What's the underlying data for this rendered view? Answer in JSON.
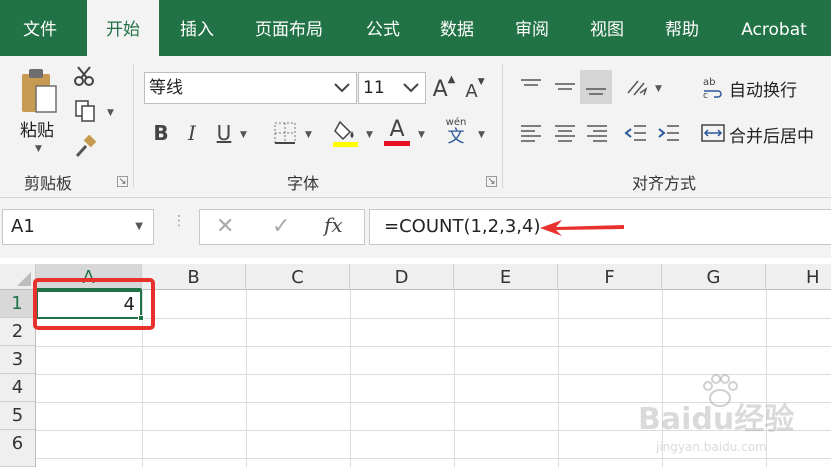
{
  "tabs": [
    "文件",
    "开始",
    "插入",
    "页面布局",
    "公式",
    "数据",
    "审阅",
    "视图",
    "帮助",
    "Acrobat"
  ],
  "active_tab_index": 1,
  "clipboard": {
    "paste_label": "粘贴",
    "group_label": "剪贴板"
  },
  "font": {
    "name": "等线",
    "size": "11",
    "grow_label": "A",
    "shrink_label": "A",
    "bold": "B",
    "italic": "I",
    "underline": "U",
    "font_color_label": "A",
    "phonetic_top": "wén",
    "phonetic_bottom": "文",
    "group_label": "字体"
  },
  "alignment": {
    "wrap_text": "自动换行",
    "merge_center": "合并后居中",
    "group_label": "对齐方式"
  },
  "formula_bar": {
    "name_box": "A1",
    "fx_label": "fx",
    "formula": "=COUNT(1,2,3,4)"
  },
  "columns": [
    "A",
    "B",
    "C",
    "D",
    "E",
    "F",
    "G",
    "H"
  ],
  "rows": [
    "1",
    "2",
    "3",
    "4",
    "5",
    "6"
  ],
  "cells": {
    "A1": "4"
  },
  "colors": {
    "accent": "#217346",
    "highlight_red": "#e8302c",
    "fill_yellow": "#ffff00",
    "font_red": "#e81123"
  },
  "watermark": {
    "brand": "Baidu经验",
    "url": "jingyan.baidu.com"
  }
}
